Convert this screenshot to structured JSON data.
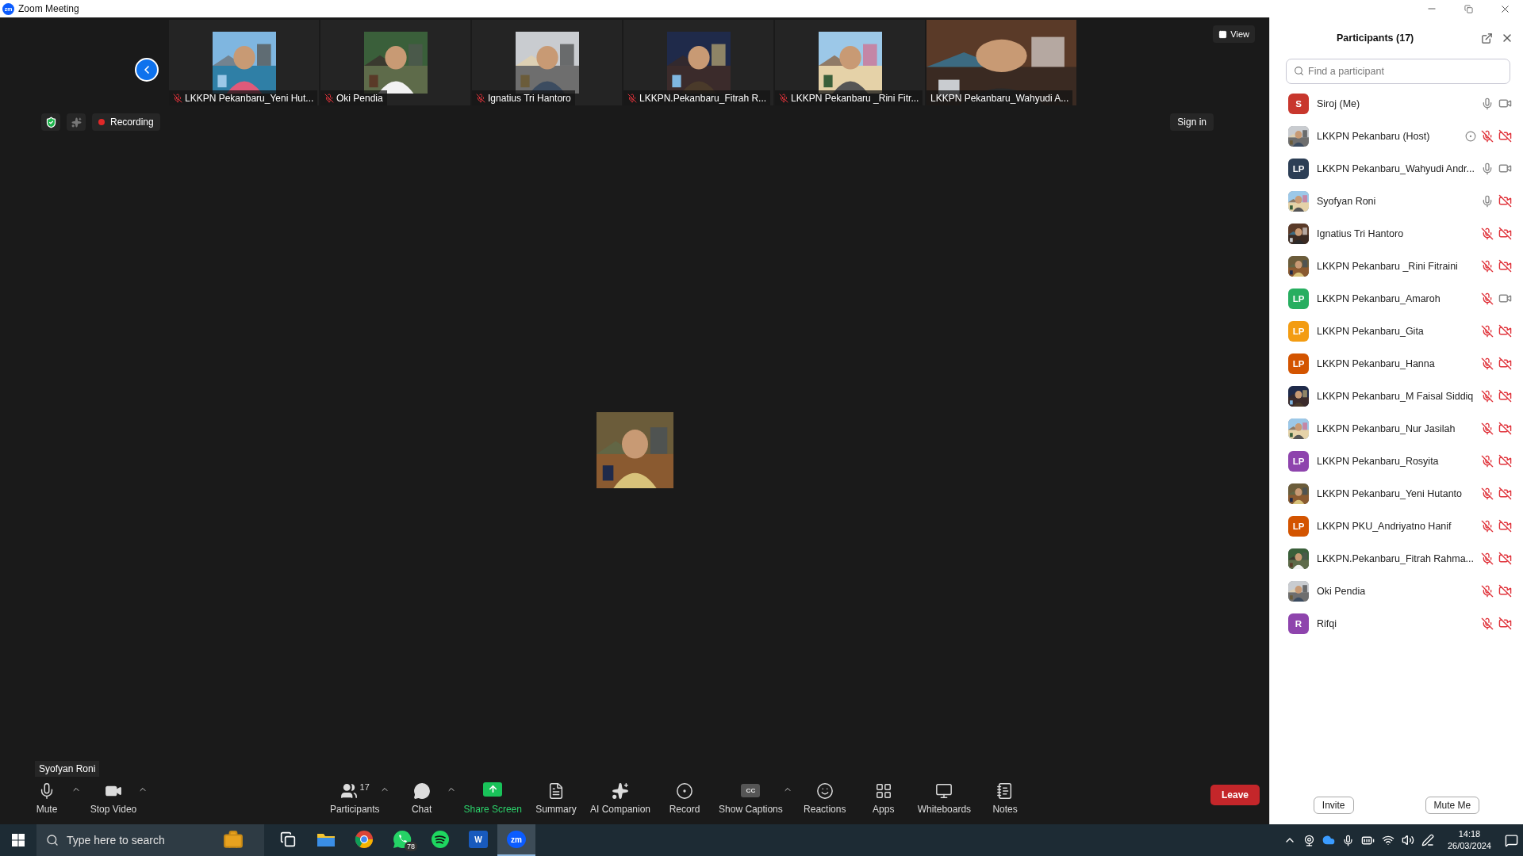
{
  "window": {
    "logo": "zm",
    "title": "Zoom Meeting"
  },
  "gallery": [
    {
      "name": "LKKPN Pekanbaru_Yeni Hut...",
      "muted": true,
      "kind": "thumbnail"
    },
    {
      "name": "Oki Pendia",
      "muted": true,
      "kind": "thumbnail"
    },
    {
      "name": "Ignatius Tri Hantoro",
      "muted": true,
      "kind": "thumbnail"
    },
    {
      "name": "LKKPN.Pekanbaru_Fitrah R...",
      "muted": true,
      "kind": "thumbnail"
    },
    {
      "name": "LKKPN Pekanbaru _Rini Fitr...",
      "muted": true,
      "kind": "thumbnail"
    },
    {
      "name": "LKKPN Pekanbaru_Wahyudi A...",
      "muted": false,
      "kind": "full"
    }
  ],
  "view_button": "View",
  "recording": {
    "label": "Recording"
  },
  "sign_in": "Sign in",
  "active_speaker": "Syofyan Roni",
  "toolbar": [
    {
      "kind": "mic",
      "label": "Mute",
      "caret": true
    },
    {
      "kind": "video",
      "label": "Stop Video",
      "caret": true
    },
    {
      "kind": "participants",
      "label": "Participants",
      "badge": "17",
      "caret": true
    },
    {
      "kind": "chat",
      "label": "Chat",
      "caret": true
    },
    {
      "kind": "share",
      "label": "Share Screen",
      "caret": false
    },
    {
      "kind": "summary",
      "label": "Summary",
      "caret": false
    },
    {
      "kind": "ai",
      "label": "AI Companion",
      "caret": false
    },
    {
      "kind": "record",
      "label": "Record",
      "caret": false
    },
    {
      "kind": "captions",
      "label": "Show Captions",
      "glyph": "CC",
      "caret": true
    },
    {
      "kind": "reactions",
      "label": "Reactions",
      "caret": false
    },
    {
      "kind": "apps",
      "label": "Apps",
      "caret": false
    },
    {
      "kind": "whiteboards",
      "label": "Whiteboards",
      "caret": false
    },
    {
      "kind": "notes",
      "label": "Notes",
      "caret": false
    }
  ],
  "leave_button": "Leave",
  "panel": {
    "title": "Participants (17)",
    "search": {
      "placeholder": "Find a participant"
    },
    "participants": [
      {
        "name": "Siroj (Me)",
        "kind": "initials",
        "initials": "S",
        "color": "#c8372d",
        "mic_muted": false,
        "video_off": false,
        "recording": false
      },
      {
        "name": "LKKPN Pekanbaru (Host)",
        "kind": "picture",
        "mic_muted": true,
        "video_off": true,
        "recording": true
      },
      {
        "name": "LKKPN Pekanbaru_Wahyudi Andr...",
        "kind": "initials",
        "initials": "LP",
        "color": "#2c3e55",
        "mic_muted": false,
        "video_off": false,
        "recording": false
      },
      {
        "name": "Syofyan Roni",
        "kind": "picture",
        "mic_muted": false,
        "video_off": true,
        "recording": false
      },
      {
        "name": "Ignatius Tri Hantoro",
        "kind": "picture",
        "mic_muted": true,
        "video_off": true,
        "recording": false
      },
      {
        "name": "LKKPN Pekanbaru _Rini Fitraini",
        "kind": "picture",
        "mic_muted": true,
        "video_off": true,
        "recording": false
      },
      {
        "name": "LKKPN Pekanbaru_Amaroh",
        "kind": "initials",
        "initials": "LP",
        "color": "#27ae60",
        "mic_muted": true,
        "video_off": false,
        "recording": false
      },
      {
        "name": "LKKPN Pekanbaru_Gita",
        "kind": "initials",
        "initials": "LP",
        "color": "#f39c12",
        "mic_muted": true,
        "video_off": true,
        "recording": false
      },
      {
        "name": "LKKPN Pekanbaru_Hanna",
        "kind": "initials",
        "initials": "LP",
        "color": "#d35400",
        "mic_muted": true,
        "video_off": true,
        "recording": false
      },
      {
        "name": "LKKPN Pekanbaru_M Faisal Siddiq",
        "kind": "picture",
        "mic_muted": true,
        "video_off": true,
        "recording": false
      },
      {
        "name": "LKKPN Pekanbaru_Nur Jasilah",
        "kind": "picture",
        "mic_muted": true,
        "video_off": true,
        "recording": false
      },
      {
        "name": "LKKPN Pekanbaru_Rosyita",
        "kind": "initials",
        "initials": "LP",
        "color": "#8e44ad",
        "mic_muted": true,
        "video_off": true,
        "recording": false
      },
      {
        "name": "LKKPN Pekanbaru_Yeni Hutanto",
        "kind": "picture",
        "mic_muted": true,
        "video_off": true,
        "recording": false
      },
      {
        "name": "LKKPN PKU_Andriyatno Hanif",
        "kind": "initials",
        "initials": "LP",
        "color": "#d35400",
        "mic_muted": true,
        "video_off": true,
        "recording": false
      },
      {
        "name": "LKKPN.Pekanbaru_Fitrah Rahma...",
        "kind": "picture",
        "mic_muted": true,
        "video_off": true,
        "recording": false
      },
      {
        "name": "Oki Pendia",
        "kind": "picture",
        "mic_muted": true,
        "video_off": true,
        "recording": false
      },
      {
        "name": "Rifqi",
        "kind": "initials",
        "initials": "R",
        "color": "#8e44ad",
        "mic_muted": true,
        "video_off": true,
        "recording": false
      }
    ],
    "buttons": [
      "Invite",
      "Mute Me"
    ]
  },
  "taskbar": {
    "search": {
      "placeholder": "Type here to search"
    },
    "apps": [
      {
        "kind": "taskview",
        "selected": false
      },
      {
        "kind": "folder",
        "selected": false
      },
      {
        "kind": "browser",
        "selected": false
      },
      {
        "kind": "chat",
        "badge": "78",
        "selected": false
      },
      {
        "kind": "music",
        "selected": false
      },
      {
        "kind": "word",
        "glyph": "W",
        "selected": false
      },
      {
        "kind": "zoom",
        "glyph": "zm",
        "selected": true
      }
    ],
    "time": "14:18",
    "date": "26/03/2024"
  }
}
